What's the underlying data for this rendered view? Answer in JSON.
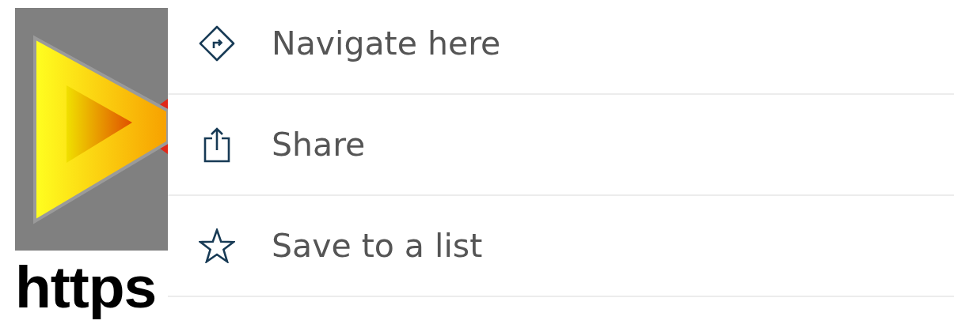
{
  "link_label": "https",
  "menu": [
    {
      "kind": "navigate",
      "label": "Navigate here"
    },
    {
      "kind": "share",
      "label": "Share"
    },
    {
      "kind": "save",
      "label": "Save to a list"
    }
  ]
}
